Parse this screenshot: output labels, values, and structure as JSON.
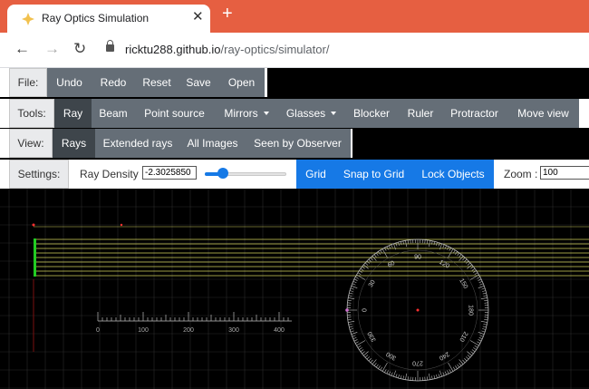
{
  "browser": {
    "tab_title": "Ray Optics Simulation",
    "url_host": "ricktu288.github.io",
    "url_path": "/ray-optics/simulator/"
  },
  "file_bar": {
    "label": "File:",
    "buttons": [
      "Undo",
      "Redo",
      "Reset",
      "Save",
      "Open"
    ]
  },
  "tools_bar": {
    "label": "Tools:",
    "buttons": [
      "Ray",
      "Beam",
      "Point source",
      "Mirrors",
      "Glasses",
      "Blocker",
      "Ruler",
      "Protractor",
      "Move view"
    ],
    "selected": "Ray"
  },
  "view_bar": {
    "label": "View:",
    "buttons": [
      "Rays",
      "Extended rays",
      "All Images",
      "Seen by Observer"
    ],
    "selected": "Rays"
  },
  "settings_bar": {
    "label": "Settings:",
    "ray_density_label": "Ray Density :",
    "ray_density_value": "-2.3025850",
    "ray_density_slider": 0.22,
    "toggles": [
      "Grid",
      "Snap to Grid",
      "Lock Objects"
    ],
    "zoom_label": "Zoom :",
    "zoom_value": "100"
  },
  "ruler": {
    "tick_labels": [
      "0",
      "100",
      "200",
      "300",
      "400"
    ]
  },
  "protractor": {
    "angle_labels": [
      "0",
      "30",
      "60",
      "90",
      "120",
      "150",
      "180",
      "210",
      "240",
      "270",
      "300",
      "330"
    ]
  },
  "colors": {
    "browser_accent": "#e65f41",
    "toolbar_button": "#656e77",
    "toolbar_selected": "#3e454b",
    "toggle_active": "#1679e6",
    "ray": "#ffff66",
    "ray_source": "#22cc22"
  },
  "icons": [
    "ray-optics-favicon",
    "close-icon",
    "new-tab-icon",
    "back-arrow-icon",
    "forward-arrow-icon",
    "reload-icon",
    "lock-icon",
    "dropdown-caret-icon"
  ]
}
